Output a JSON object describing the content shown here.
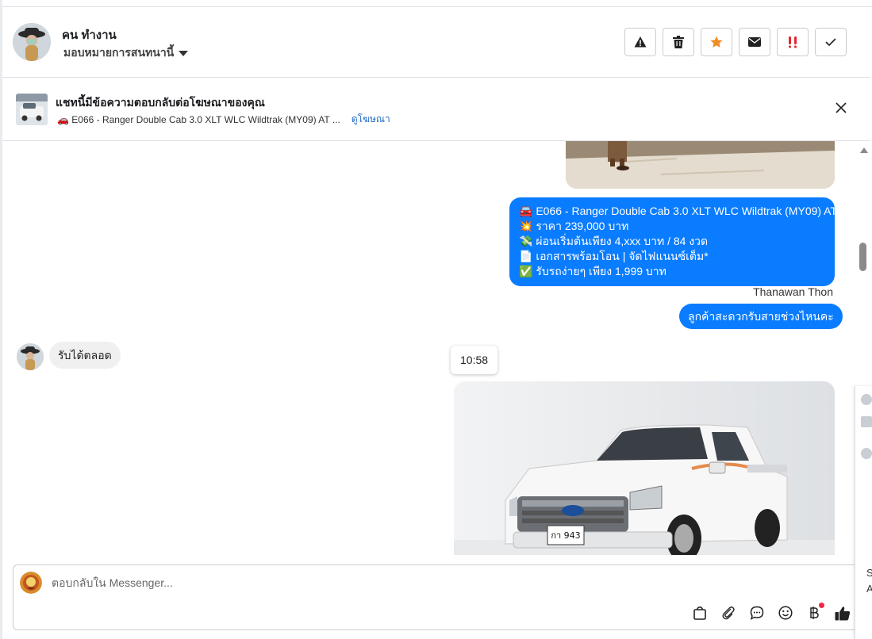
{
  "header": {
    "contact_name": "คน ทำงาน",
    "assign_label": "มอบหมายการสนทนานี้",
    "actions": [
      "report-icon",
      "trash-icon",
      "star-icon",
      "mail-icon",
      "important-icon",
      "check-icon"
    ]
  },
  "ad_banner": {
    "title": "แชทนี้มีข้อความตอบกลับต่อโฆษณาของคุณ",
    "ad_text": "🚗 E066 - Ranger Double Cab 3.0 XLT WLC Wildtrak (MY09) AT ...",
    "view_ad_label": "ดูโฆษณา"
  },
  "messages": {
    "outgoing_1_lines": [
      "🚘 E066 - Ranger Double Cab 3.0 XLT WLC Wildtrak (MY09) AT",
      "💥 ราคา 239,000 บาท",
      "💸 ผ่อนเริ่มต้นเพียง 4,xxx บาท / 84 งวด",
      "📄 เอกสารพร้อมโอน | จัดไฟแนนซ์เต็ม*",
      "✅ รับรถง่ายๆ เพียง 1,999 บาท"
    ],
    "sender_name": "Thanawan Thon",
    "outgoing_2": "ลูกค้าสะดวกรับสายช่วงไหนคะ",
    "incoming_1": "รับได้ตลอด",
    "time_chip": "10:58",
    "plate_text": "กา 943"
  },
  "composer": {
    "placeholder": "ตอบกลับใน Messenger..."
  },
  "edge_panel": {
    "letters": [
      "S",
      "A"
    ]
  },
  "colors": {
    "accent": "#0a7cff",
    "star": "#f28c28",
    "important": "#e0282e",
    "link": "#1d69c6"
  }
}
